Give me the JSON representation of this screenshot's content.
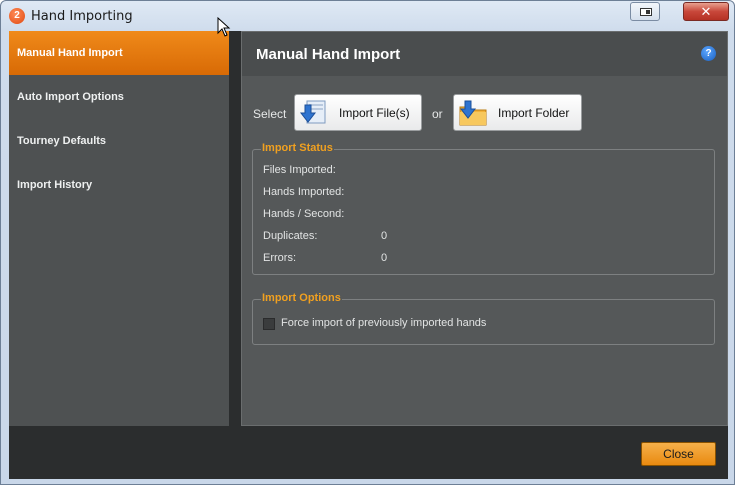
{
  "window": {
    "app_icon": "2",
    "title": "Hand Importing",
    "close_glyph": "✕"
  },
  "sidebar": {
    "items": [
      {
        "label": "Manual Hand Import",
        "active": true
      },
      {
        "label": "Auto Import Options",
        "active": false
      },
      {
        "label": "Tourney Defaults",
        "active": false
      },
      {
        "label": "Import History",
        "active": false
      }
    ]
  },
  "main": {
    "title": "Manual Hand Import",
    "help_glyph": "?",
    "select_label": "Select",
    "import_files_label": "Import File(s)",
    "or_label": "or",
    "import_folder_label": "Import Folder",
    "status": {
      "legend": "Import Status",
      "rows": [
        {
          "label": "Files Imported:",
          "value": ""
        },
        {
          "label": "Hands Imported:",
          "value": ""
        },
        {
          "label": "Hands / Second:",
          "value": ""
        },
        {
          "label": "Duplicates:",
          "value": "0"
        },
        {
          "label": "Errors:",
          "value": "0"
        }
      ]
    },
    "options": {
      "legend": "Import Options",
      "force_import_label": "Force import of previously imported hands",
      "force_import_checked": false
    }
  },
  "footer": {
    "close_label": "Close"
  },
  "colors": {
    "accent": "#e98a10",
    "legend": "#f0a020",
    "panel": "#555859",
    "sidebar": "#4e5152"
  },
  "icons": [
    "app-logo-icon",
    "restore-icon",
    "close-icon",
    "file-import-icon",
    "folder-import-icon",
    "help-icon",
    "mouse-cursor-icon"
  ]
}
